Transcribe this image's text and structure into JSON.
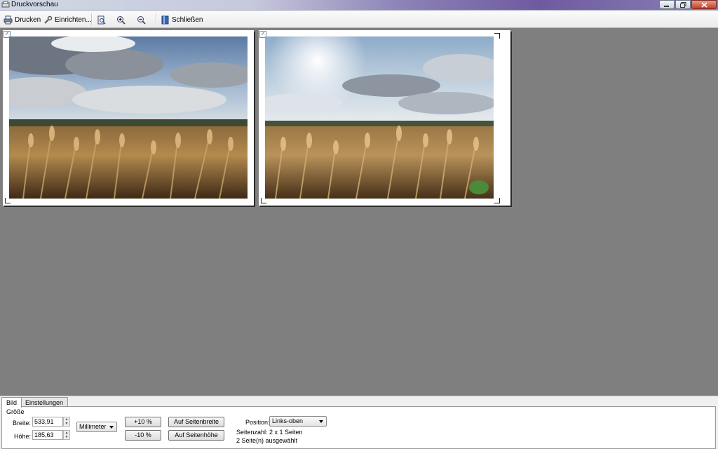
{
  "window": {
    "title": "Druckvorschau",
    "buttons": [
      "minimize-icon",
      "maximize-icon",
      "close-icon"
    ]
  },
  "toolbar": {
    "print_label": "Drucken",
    "setup_label": "Einrichten...",
    "close_label": "Schließen",
    "icons": [
      "printer-icon",
      "wrench-icon",
      "page-view-icon",
      "zoom-in-icon",
      "zoom-out-icon",
      "close-book-icon"
    ]
  },
  "pages": [
    {
      "selected": true,
      "image": "wheat-field-left-icon"
    },
    {
      "selected": true,
      "image": "wheat-field-right-icon"
    }
  ],
  "bottom": {
    "tabs": [
      "Bild",
      "Einstellungen"
    ],
    "group_label": "Größe",
    "width_label": "Breite:",
    "width_value": "533,91",
    "height_label": "Höhe:",
    "height_value": "185,63",
    "unit": "Millimeter",
    "plus_label": "+10 %",
    "minus_label": "-10 %",
    "fit_width_label": "Auf Seitenbreite",
    "fit_height_label": "Auf Seitenhöhe",
    "position_label": "Position:",
    "position_value": "Links-oben",
    "page_count": "Seitenzahl: 2 x 1 Seiten",
    "selected_info": "2 Seite(n) ausgewählt"
  },
  "colors": {
    "workspace": "#7f7f7f",
    "titlebar_accent": "#6f5aa0",
    "toolbar": "#f2f2f2"
  }
}
